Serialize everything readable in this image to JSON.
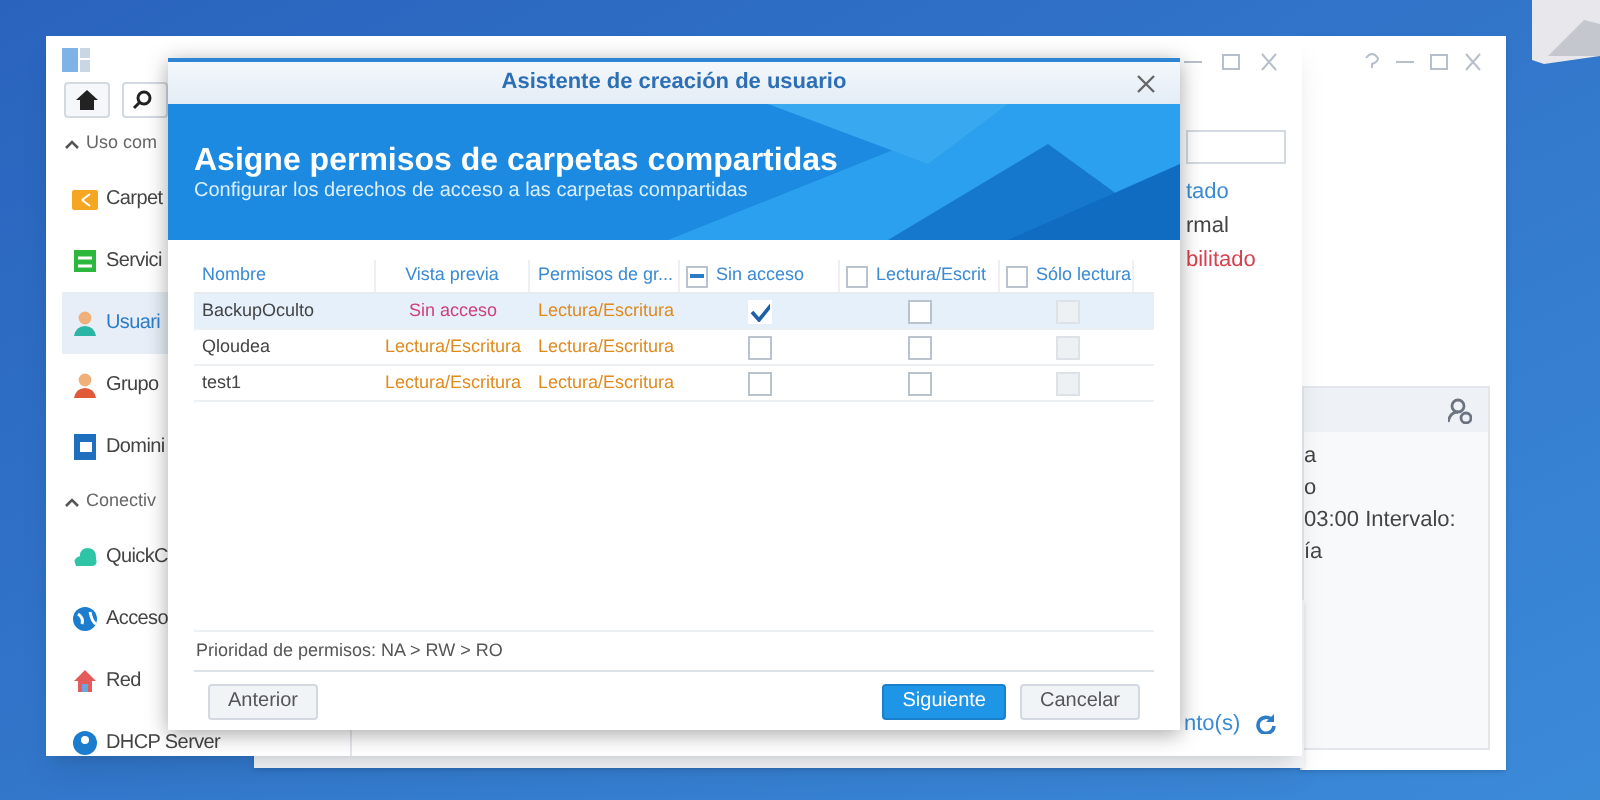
{
  "control_panel": {
    "sidebar": [
      {
        "kind": "section",
        "label": "Uso com",
        "expanded": true
      },
      {
        "kind": "item",
        "label": "Carpet",
        "selected": false
      },
      {
        "kind": "item",
        "label": "Servici",
        "selected": false
      },
      {
        "kind": "item",
        "label": "Usuari",
        "selected": true
      },
      {
        "kind": "item",
        "label": "Grupo",
        "selected": false
      },
      {
        "kind": "item",
        "label": "Domini",
        "selected": false
      },
      {
        "kind": "section",
        "label": "Conectiv",
        "expanded": true
      },
      {
        "kind": "item",
        "label": "QuickC",
        "selected": false
      },
      {
        "kind": "item",
        "label": "Acceso",
        "selected": false
      },
      {
        "kind": "item",
        "label": "Red",
        "selected": false
      },
      {
        "kind": "item",
        "label": "DHCP Server",
        "selected": false
      }
    ],
    "table": {
      "column": "tado",
      "rows": [
        {
          "text": "rmal",
          "color": "#444444"
        },
        {
          "text": "bilitado",
          "color": "#d8404f"
        }
      ]
    },
    "footer_link": "nto(s)"
  },
  "side_window": {
    "lines": [
      "a",
      "o",
      "03:00 Intervalo:",
      "ía"
    ]
  },
  "dialog": {
    "title": "Asistente de creación de usuario",
    "heading": "Asigne permisos de carpetas compartidas",
    "subheading": "Configurar los derechos de acceso a las carpetas compartidas",
    "columns": [
      {
        "label": "Nombre"
      },
      {
        "label": "Vista previa"
      },
      {
        "label": "Permisos de gr..."
      },
      {
        "label": "Sin acceso",
        "kind": "check",
        "partial": true
      },
      {
        "label": "Lectura/Escrit",
        "kind": "check",
        "partial": false
      },
      {
        "label": "Sólo lectura",
        "kind": "check",
        "partial": false
      }
    ],
    "rows": [
      {
        "name": "BackupOculto",
        "selected": true,
        "preview": {
          "text": "Sin acceso",
          "color": "#d0407a"
        },
        "group": "Lectura/Escritura",
        "checks": [
          {
            "checked": true,
            "disabled": false
          },
          {
            "checked": false,
            "disabled": false
          },
          {
            "checked": false,
            "disabled": true
          }
        ]
      },
      {
        "name": "Qloudea",
        "selected": false,
        "preview": {
          "text": "Lectura/Escritura",
          "color": "#e08a1e"
        },
        "group": "Lectura/Escritura",
        "checks": [
          {
            "checked": false,
            "disabled": false
          },
          {
            "checked": false,
            "disabled": false
          },
          {
            "checked": false,
            "disabled": true
          }
        ]
      },
      {
        "name": "test1",
        "selected": false,
        "preview": {
          "text": "Lectura/Escritura",
          "color": "#e08a1e"
        },
        "group": "Lectura/Escritura",
        "checks": [
          {
            "checked": false,
            "disabled": false
          },
          {
            "checked": false,
            "disabled": false
          },
          {
            "checked": false,
            "disabled": true
          }
        ]
      }
    ],
    "note": "Prioridad de permisos: NA > RW > RO",
    "buttons": [
      {
        "label": "Anterior",
        "kind": "secondary"
      },
      {
        "label": "Siguiente",
        "kind": "primary"
      },
      {
        "label": "Cancelar",
        "kind": "secondary"
      }
    ]
  }
}
